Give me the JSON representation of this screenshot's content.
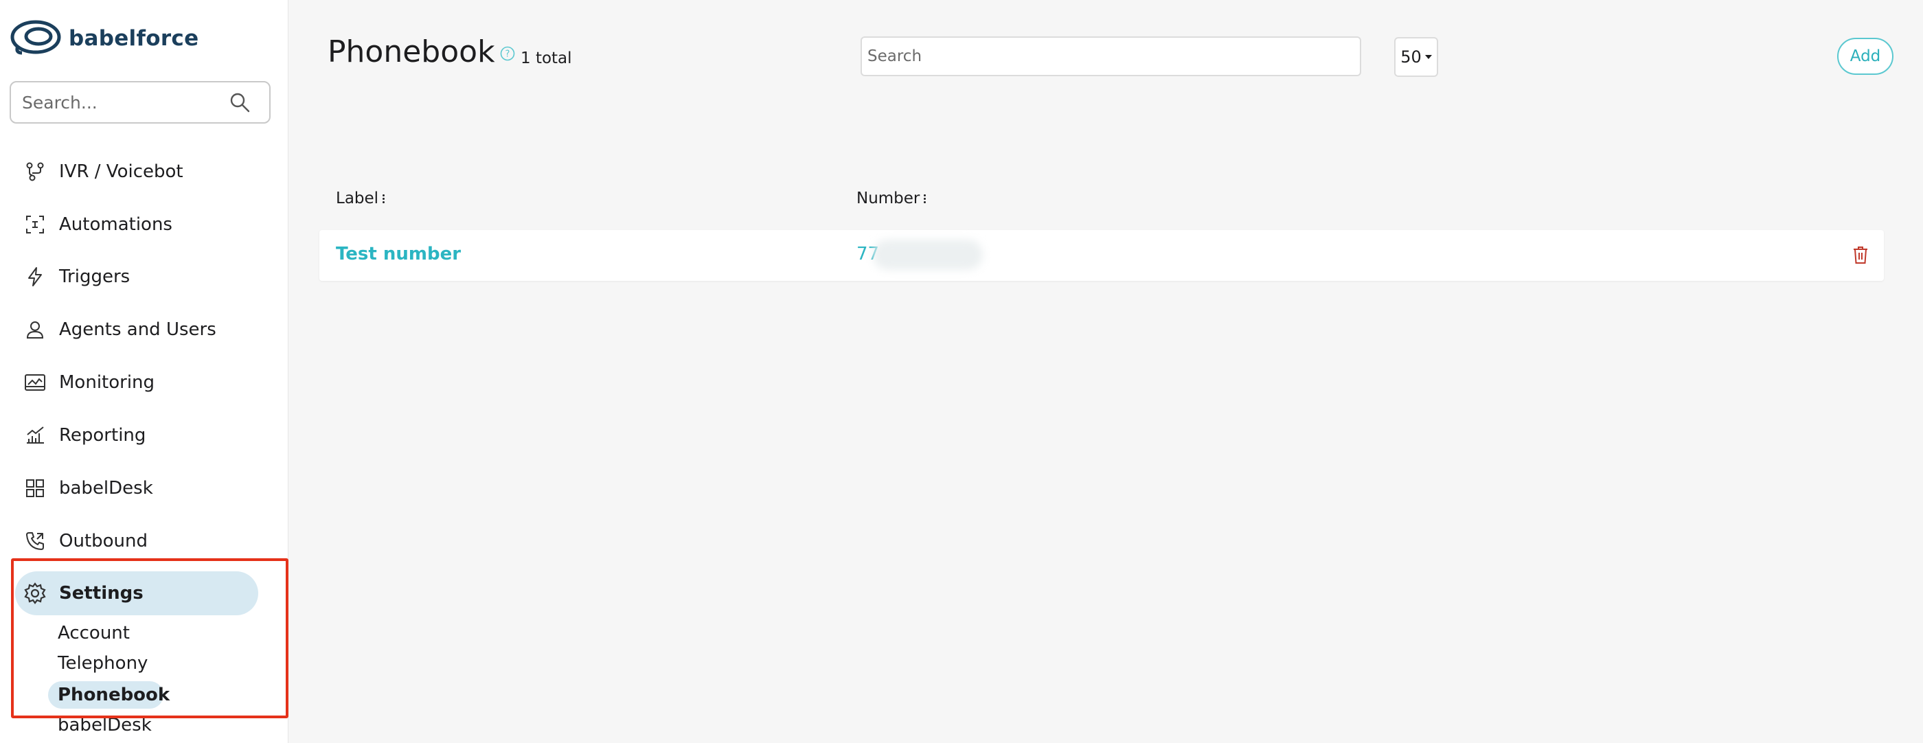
{
  "app": {
    "logo_text": "babelforce"
  },
  "sidebar": {
    "search_placeholder": "Search...",
    "nav": [
      {
        "label": "IVR / Voicebot",
        "icon": "flow-icon"
      },
      {
        "label": "Automations",
        "icon": "automation-icon"
      },
      {
        "label": "Triggers",
        "icon": "lightning-icon"
      },
      {
        "label": "Agents and Users",
        "icon": "user-icon"
      },
      {
        "label": "Monitoring",
        "icon": "monitor-icon"
      },
      {
        "label": "Reporting",
        "icon": "chart-icon"
      },
      {
        "label": "babelDesk",
        "icon": "grid-icon"
      },
      {
        "label": "Outbound",
        "icon": "phone-outbound-icon"
      }
    ],
    "settings": {
      "label": "Settings",
      "icon": "gear-icon",
      "sub_items": [
        {
          "label": "Account"
        },
        {
          "label": "Telephony"
        },
        {
          "label": "Phonebook",
          "active": true
        },
        {
          "label": "babelDesk"
        }
      ]
    }
  },
  "main": {
    "title": "Phonebook",
    "total": "1 total",
    "search_placeholder": "Search",
    "page_size": "50",
    "add_label": "Add",
    "columns": [
      {
        "label": "Label"
      },
      {
        "label": "Number"
      }
    ],
    "rows": [
      {
        "label": "Test number",
        "number": "77"
      }
    ]
  },
  "colors": {
    "accent": "#2bb5c2",
    "active_bg": "#d7e9f2",
    "highlight": "#e5321a",
    "delete": "#c0392b",
    "logo": "#1b3f5c"
  }
}
